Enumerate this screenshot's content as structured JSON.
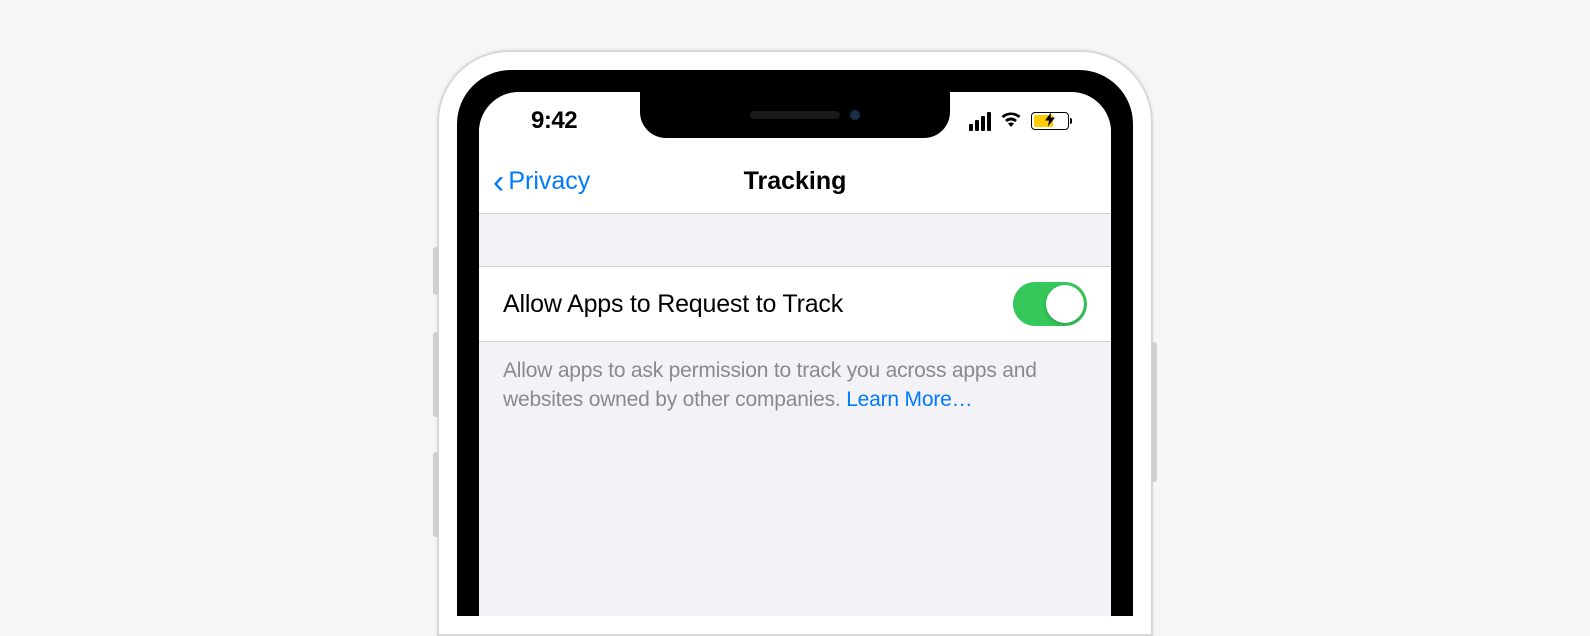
{
  "statusBar": {
    "time": "9:42"
  },
  "navBar": {
    "backLabel": "Privacy",
    "title": "Tracking"
  },
  "setting": {
    "label": "Allow Apps to Request to Track",
    "enabled": true
  },
  "footer": {
    "description": "Allow apps to ask permission to track you across apps and websites owned by other companies. ",
    "learnMore": "Learn More…"
  }
}
